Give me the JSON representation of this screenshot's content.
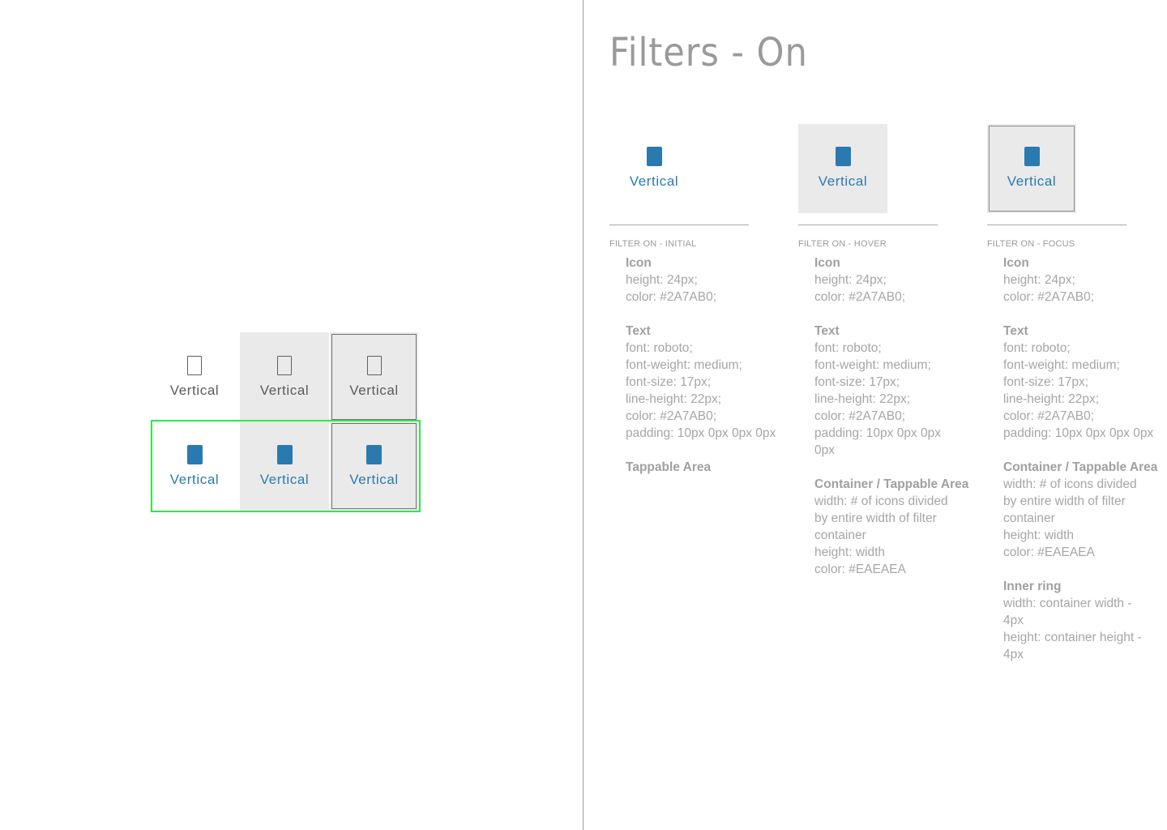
{
  "label": "Vertical",
  "colors": {
    "accent": "#2A7AB0",
    "container": "#EAEAEA",
    "focus_outline": "#2EE84A"
  },
  "title": "Filters - On",
  "states": [
    {
      "caption": "FILTER ON - INITIAL",
      "sections": [
        {
          "head": "Icon",
          "lines": [
            "height: 24px;",
            "color: #2A7AB0;"
          ]
        },
        {
          "head": "Text",
          "lines": [
            "font: roboto;",
            "font-weight: medium;",
            "font-size: 17px;",
            "line-height: 22px;",
            "color: #2A7AB0;",
            "padding: 10px 0px 0px 0px"
          ]
        },
        {
          "head": "Tappable Area",
          "lines": []
        }
      ]
    },
    {
      "caption": "FILTER ON - HOVER",
      "sections": [
        {
          "head": "Icon",
          "lines": [
            "height: 24px;",
            "color: #2A7AB0;"
          ]
        },
        {
          "head": "Text",
          "lines": [
            "font: roboto;",
            "font-weight: medium;",
            "font-size: 17px;",
            "line-height: 22px;",
            "color: #2A7AB0;",
            "padding: 10px 0px 0px",
            "0px"
          ]
        },
        {
          "head": "Container / Tappable Area",
          "lines": [
            "width: # of icons divided",
            "by entire width of filter",
            "container",
            "height: width",
            "color: #EAEAEA"
          ]
        }
      ]
    },
    {
      "caption": "FILTER ON - FOCUS",
      "sections": [
        {
          "head": "Icon",
          "lines": [
            "height: 24px;",
            "color: #2A7AB0;"
          ]
        },
        {
          "head": "Text",
          "lines": [
            "font: roboto;",
            "font-weight: medium;",
            "font-size: 17px;",
            "line-height: 22px;",
            "color: #2A7AB0;",
            "padding: 10px 0px 0px 0px"
          ]
        },
        {
          "head": "Container / Tappable Area",
          "lines": [
            "width: # of icons divided",
            "by entire width of filter",
            "container",
            "height: width",
            "color: #EAEAEA"
          ]
        },
        {
          "head": "Inner ring",
          "lines": [
            "width: container width -",
            "4px",
            "height: container height -",
            "4px"
          ]
        }
      ]
    }
  ]
}
